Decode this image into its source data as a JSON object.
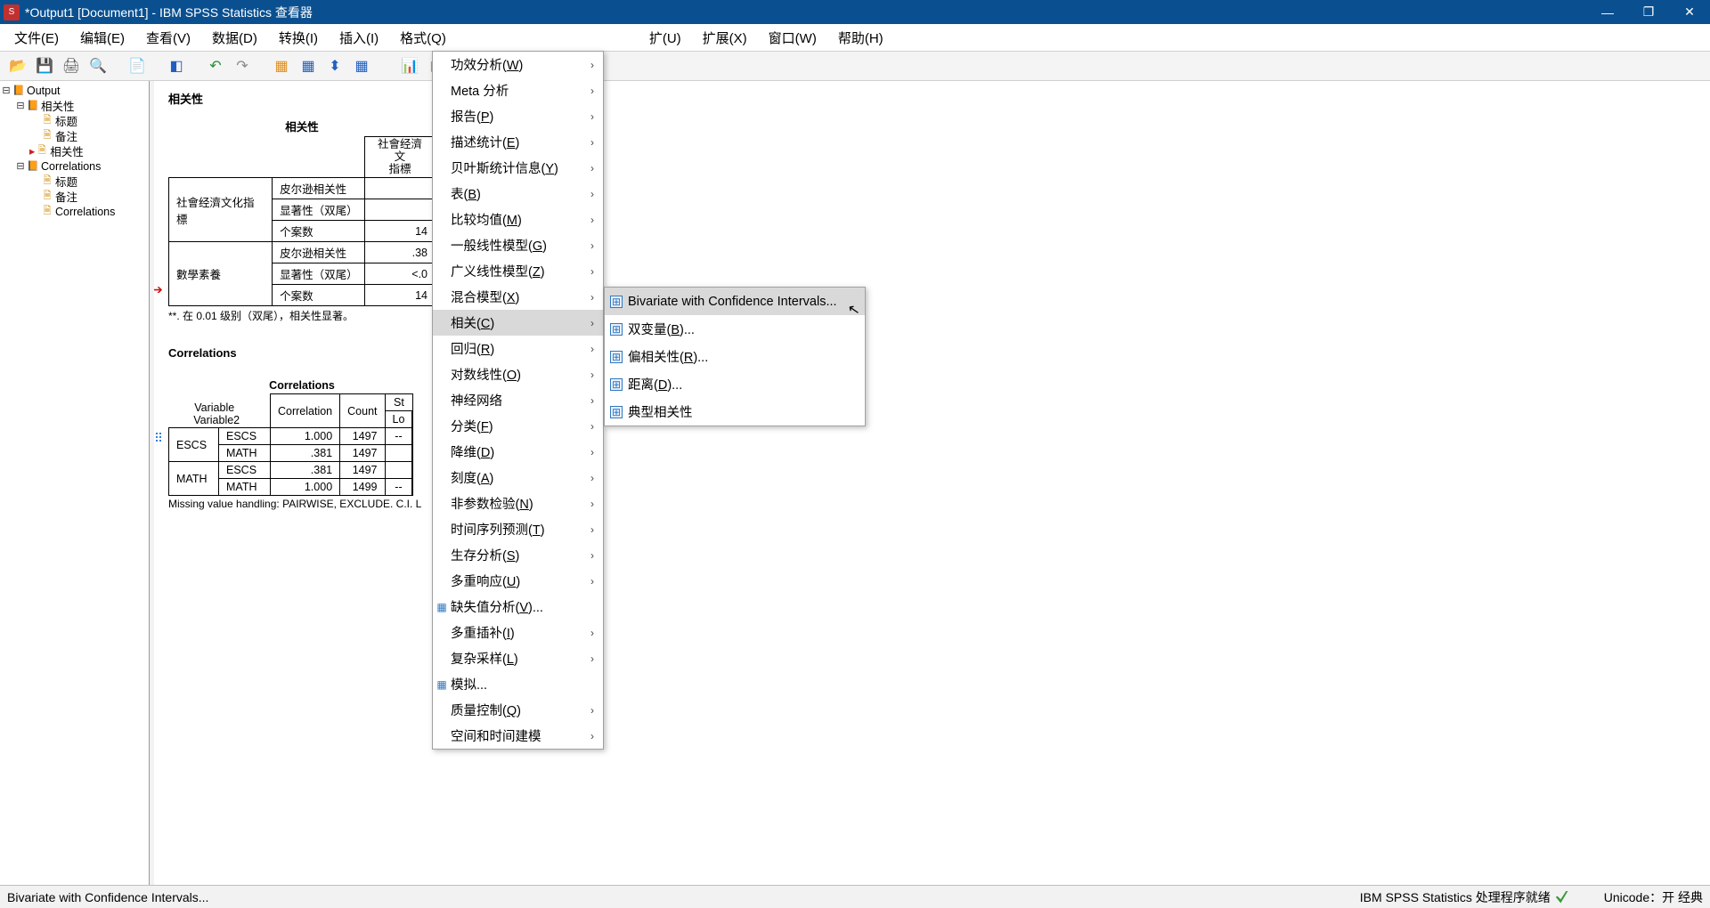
{
  "titlebar": {
    "text": "*Output1 [Document1] - IBM SPSS Statistics 查看器"
  },
  "window": {
    "min": "—",
    "max": "❐",
    "close": "✕"
  },
  "menubar": {
    "items": [
      "文件(E)",
      "编辑(E)",
      "查看(V)",
      "数据(D)",
      "转换(I)",
      "插入(I)",
      "格式(Q)",
      "",
      "扩(U)",
      "扩展(X)",
      "窗口(W)",
      "帮助(H)"
    ]
  },
  "nav": {
    "root": "Output",
    "g1": {
      "label": "相关性",
      "children": [
        "标题",
        "备注",
        "相关性"
      ]
    },
    "g2": {
      "label": "Correlations",
      "children": [
        "标题",
        "备注",
        "Correlations"
      ]
    }
  },
  "section1": {
    "title": "相关性",
    "caption": "相关性",
    "colhdr": [
      "社會经濟文",
      "指標"
    ],
    "rows": [
      {
        "var": "社會经濟文化指標",
        "stat": "皮尔逊相关性",
        "v": ""
      },
      {
        "var": "",
        "stat": "显著性（双尾）",
        "v": ""
      },
      {
        "var": "",
        "stat": "个案数",
        "v": "14"
      },
      {
        "var": "數學素養",
        "stat": "皮尔逊相关性",
        "v": ".38"
      },
      {
        "var": "",
        "stat": "显著性（双尾）",
        "v": "<.0"
      },
      {
        "var": "",
        "stat": "个案数",
        "v": "14"
      }
    ],
    "footnote": "**. 在 0.01 级别（双尾），相关性显著。"
  },
  "section2": {
    "title": "Correlations",
    "caption": "Correlations",
    "headers": [
      "Variable",
      "Variable2",
      "Correlation",
      "Count",
      "St",
      "Lo"
    ],
    "rows": [
      [
        "ESCS",
        "ESCS",
        "1.000",
        "1497",
        "",
        "--"
      ],
      [
        "",
        "MATH",
        ".381",
        "1497",
        "",
        ""
      ],
      [
        "MATH",
        "ESCS",
        ".381",
        "1497",
        "",
        ""
      ],
      [
        "",
        "MATH",
        "1.000",
        "1499",
        "",
        "--"
      ]
    ],
    "footnote": "Missing value handling: PAIRWISE, EXCLUDE.  C.I. L"
  },
  "dropdown": {
    "items": [
      {
        "label": "功效分析(W)",
        "arrow": true
      },
      {
        "label": "Meta 分析",
        "arrow": true
      },
      {
        "label": "报告(P)",
        "arrow": true
      },
      {
        "label": "描述统计(E)",
        "arrow": true
      },
      {
        "label": "贝叶斯统计信息(Y)",
        "arrow": true
      },
      {
        "label": "表(B)",
        "arrow": true
      },
      {
        "label": "比较均值(M)",
        "arrow": true
      },
      {
        "label": "一般线性模型(G)",
        "arrow": true
      },
      {
        "label": "广义线性模型(Z)",
        "arrow": true
      },
      {
        "label": "混合模型(X)",
        "arrow": true
      },
      {
        "label": "相关(C)",
        "arrow": true,
        "highlight": true
      },
      {
        "label": "回归(R)",
        "arrow": true
      },
      {
        "label": "对数线性(O)",
        "arrow": true
      },
      {
        "label": "神经网络",
        "arrow": true
      },
      {
        "label": "分类(F)",
        "arrow": true
      },
      {
        "label": "降维(D)",
        "arrow": true
      },
      {
        "label": "刻度(A)",
        "arrow": true
      },
      {
        "label": "非参数检验(N)",
        "arrow": true
      },
      {
        "label": "时间序列预测(T)",
        "arrow": true
      },
      {
        "label": "生存分析(S)",
        "arrow": true
      },
      {
        "label": "多重响应(U)",
        "arrow": true
      },
      {
        "label": "缺失值分析(V)...",
        "arrow": false,
        "icon": true
      },
      {
        "label": "多重插补(I)",
        "arrow": true
      },
      {
        "label": "复杂采样(L)",
        "arrow": true
      },
      {
        "label": "模拟...",
        "arrow": false,
        "icon": true
      },
      {
        "label": "质量控制(Q)",
        "arrow": true
      },
      {
        "label": "空间和时间建模",
        "arrow": true
      }
    ]
  },
  "submenu": {
    "items": [
      {
        "label": "Bivariate with Confidence Intervals...",
        "highlight": true
      },
      {
        "label": "双变量(B)..."
      },
      {
        "label": "偏相关性(R)..."
      },
      {
        "label": "距离(D)..."
      },
      {
        "label": "典型相关性"
      }
    ]
  },
  "statusbar": {
    "left": "Bivariate with Confidence Intervals...",
    "mid": "IBM SPSS Statistics 处理程序就绪",
    "right": "Unicode：开 经典"
  }
}
